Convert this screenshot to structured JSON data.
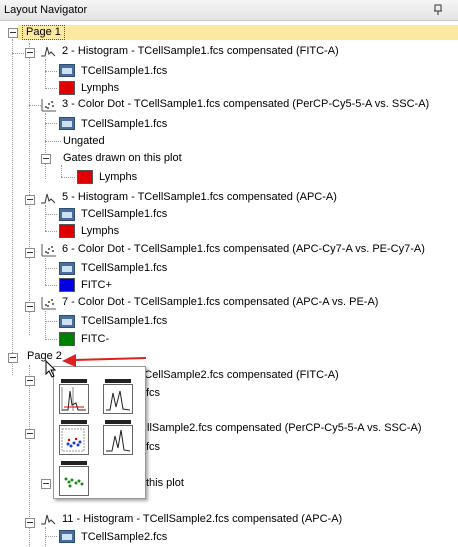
{
  "window": {
    "title": "Layout Navigator"
  },
  "page1": {
    "label": "Page 1",
    "items": [
      {
        "title": "2 - Histogram - TCellSample1.fcs compensated (FITC-A)",
        "icon": "histogram-icon",
        "file": "TCellSample1.fcs",
        "gate": "Lymphs",
        "gate_color": "#e00000"
      },
      {
        "title": "3 - Color Dot - TCellSample1.fcs compensated (PerCP-Cy5-5-A vs. SSC-A)",
        "icon": "dotplot-icon",
        "file": "TCellSample1.fcs",
        "ungated": "Ungated",
        "gates_drawn": "Gates drawn on this plot",
        "gate": "Lymphs",
        "gate_color": "#e00000"
      },
      {
        "title": "5 - Histogram - TCellSample1.fcs compensated (APC-A)",
        "icon": "histogram-icon",
        "file": "TCellSample1.fcs",
        "gate": "Lymphs",
        "gate_color": "#e00000"
      },
      {
        "title": "6 - Color Dot - TCellSample1.fcs compensated (APC-Cy7-A vs. PE-Cy7-A)",
        "icon": "dotplot-icon",
        "file": "TCellSample1.fcs",
        "gate": "FITC+",
        "gate_color": "#0000e0"
      },
      {
        "title": "7 - Color Dot - TCellSample1.fcs compensated (APC-A vs. PE-A)",
        "icon": "dotplot-icon",
        "file": "TCellSample1.fcs",
        "gate": "FITC-",
        "gate_color": "#008000"
      }
    ]
  },
  "page2": {
    "label": "Page 2",
    "items": [
      {
        "title_visible": "8 - Histogram - TCellSample2.fcs compensated (FITC-A)",
        "file_fragment": "fcs"
      },
      {
        "title_visible": "llSample2.fcs compensated (PerCP-Cy5-5-A vs. SSC-A)",
        "file_fragment": "fcs",
        "gates_fragment": "this plot"
      },
      {
        "title": "11 - Histogram - TCellSample2.fcs compensated (APC-A)",
        "file": "TCellSample2.fcs"
      }
    ]
  },
  "colors": {
    "selection": "#fbe99f",
    "arrow": "#e02020"
  }
}
